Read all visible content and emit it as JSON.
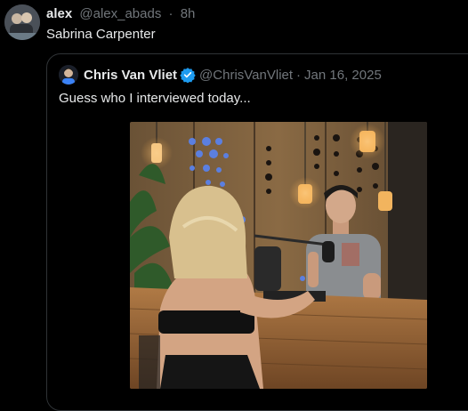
{
  "post": {
    "author_name": "alex",
    "author_handle": "@alex_abads",
    "separator": "·",
    "time": "8h",
    "text": "Sabrina Carpenter"
  },
  "quote": {
    "author_name": "Chris Van Vliet",
    "author_handle": "@ChrisVanVliet",
    "separator": "·",
    "date": "Jan 16, 2025",
    "text": "Guess who I interviewed today...",
    "verified_color": "#1d9bf0"
  },
  "icons": {
    "verified": "verified-badge-icon"
  }
}
